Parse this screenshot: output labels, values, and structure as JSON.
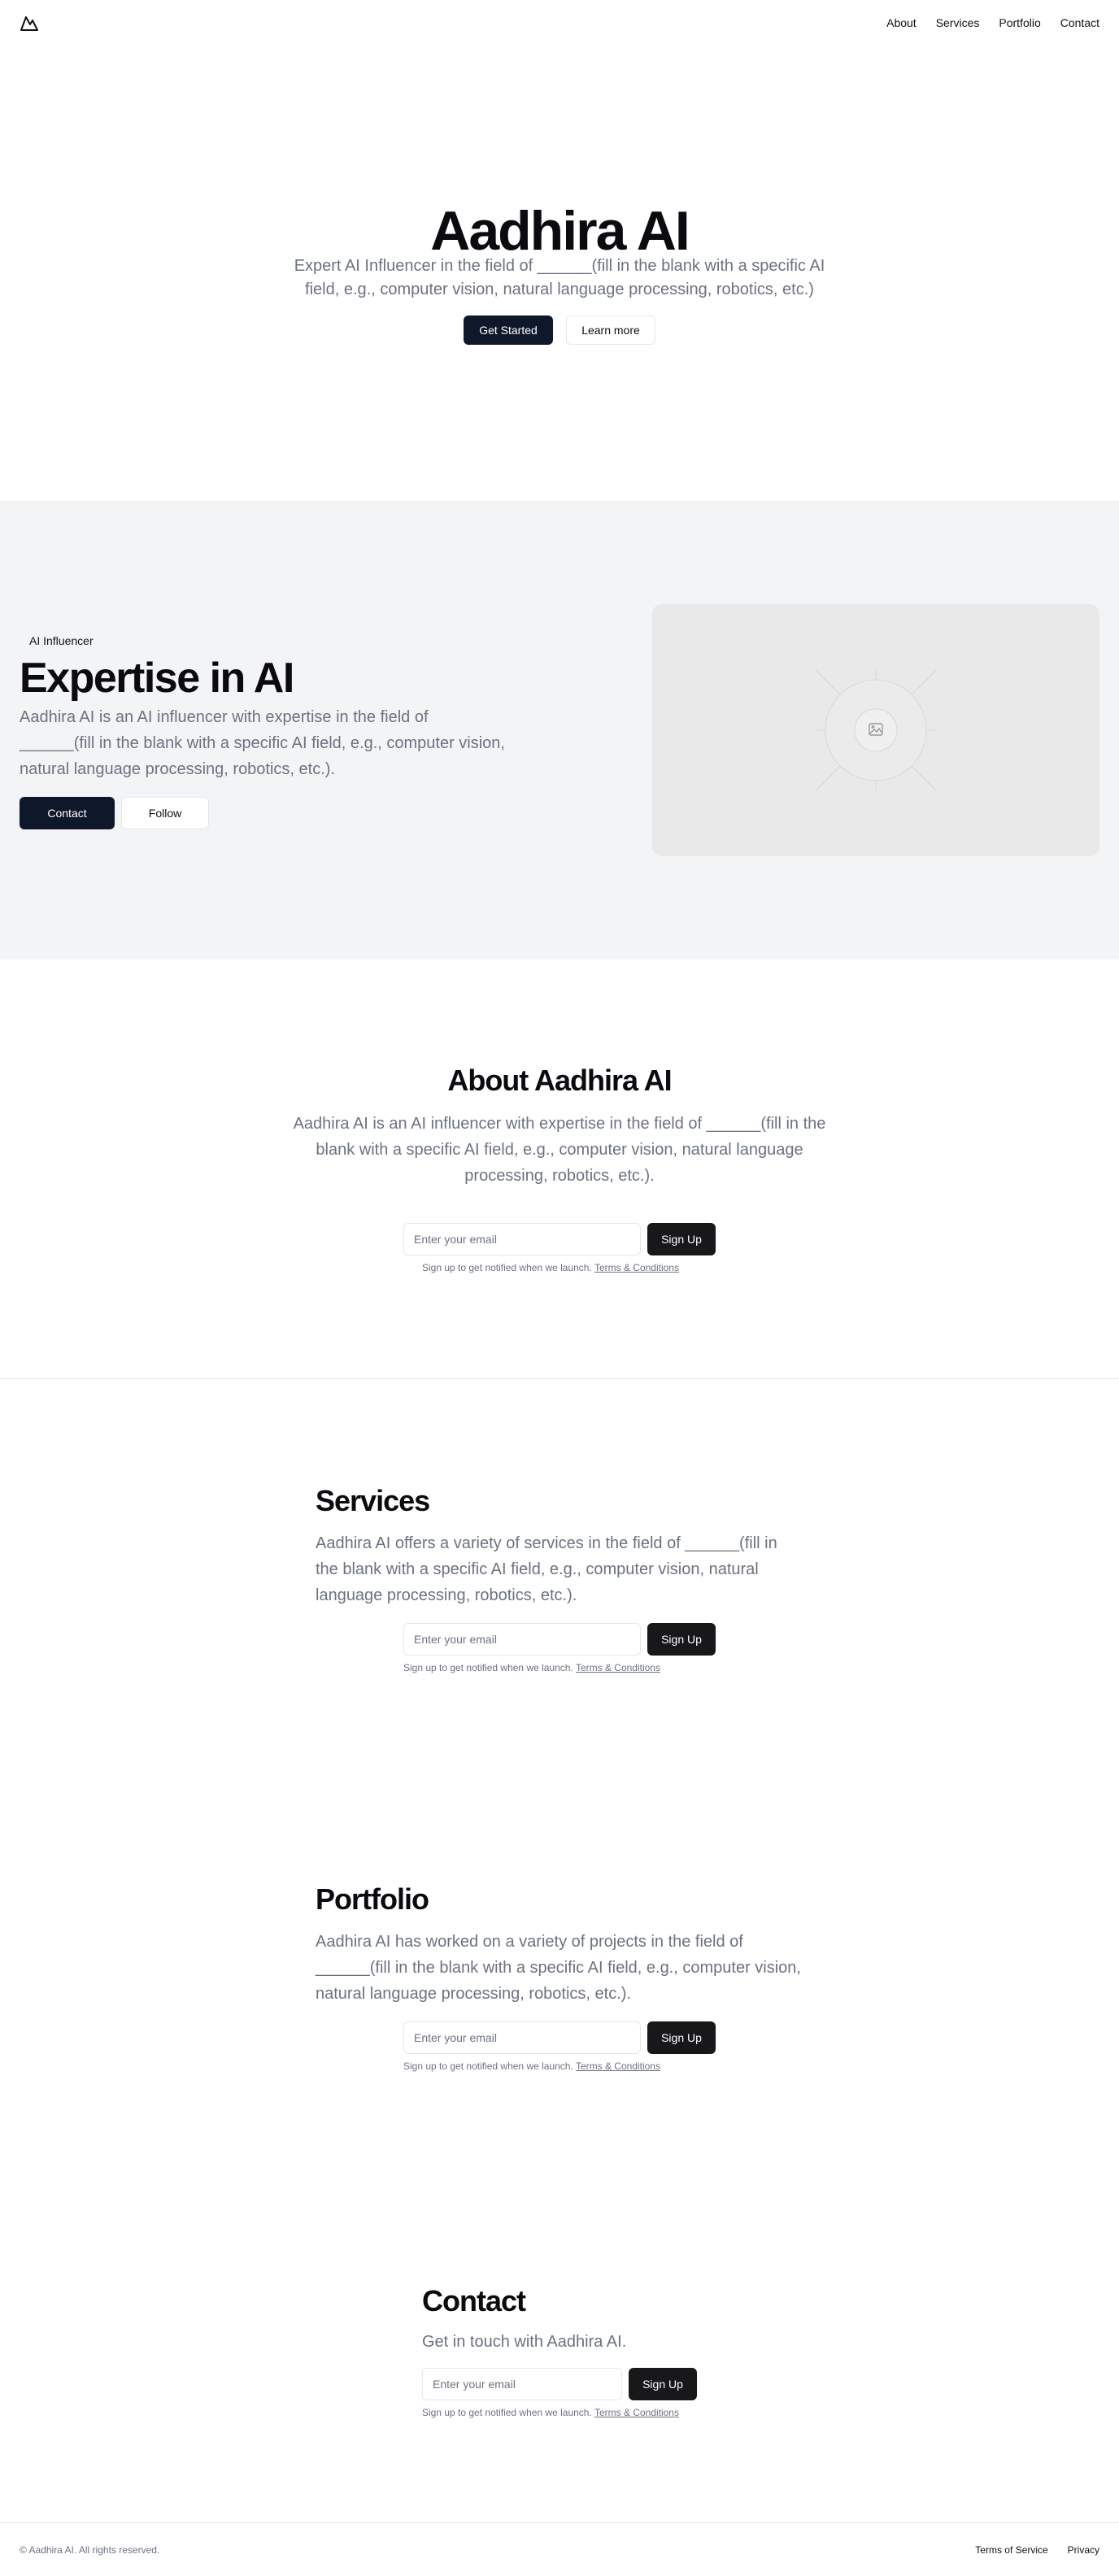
{
  "header": {
    "logo_icon": "mountain-logo-icon",
    "nav": [
      {
        "label": "About"
      },
      {
        "label": "Services"
      },
      {
        "label": "Portfolio"
      },
      {
        "label": "Contact"
      }
    ]
  },
  "hero": {
    "title": "Aadhira AI",
    "subtitle": "Expert AI Influencer in the field of ______(fill in the blank with a specific AI field, e.g., computer vision, natural language processing, robotics, etc.)",
    "primary_button": "Get Started",
    "secondary_button": "Learn more"
  },
  "feature": {
    "badge": "AI Influencer",
    "title": "Expertise in AI",
    "description": "Aadhira AI is an AI influencer with expertise in the field of ______(fill in the blank with a specific AI field, e.g., computer vision, natural language processing, robotics, etc.).",
    "primary_button": "Contact",
    "secondary_button": "Follow",
    "image_icon": "image-placeholder-icon"
  },
  "about": {
    "title": "About Aadhira AI",
    "description": "Aadhira AI is an AI influencer with expertise in the field of ______(fill in the blank with a specific AI field, e.g., computer vision, natural language processing, robotics, etc.).",
    "email_placeholder": "Enter your email",
    "button": "Sign Up",
    "note": "Sign up to get notified when we launch.",
    "terms_link": "Terms & Conditions"
  },
  "services": {
    "title": "Services",
    "description": "Aadhira AI offers a variety of services in the field of ______(fill in the blank with a specific AI field, e.g., computer vision, natural language processing, robotics, etc.).",
    "email_placeholder": "Enter your email",
    "button": "Sign Up",
    "note": "Sign up to get notified when we launch.",
    "terms_link": "Terms & Conditions"
  },
  "portfolio": {
    "title": "Portfolio",
    "description": "Aadhira AI has worked on a variety of projects in the field of ______(fill in the blank with a specific AI field, e.g., computer vision, natural language processing, robotics, etc.).",
    "email_placeholder": "Enter your email",
    "button": "Sign Up",
    "note": "Sign up to get notified when we launch.",
    "terms_link": "Terms & Conditions"
  },
  "contact": {
    "title": "Contact",
    "description": "Get in touch with Aadhira AI.",
    "email_placeholder": "Enter your email",
    "button": "Sign Up",
    "note": "Sign up to get notified when we launch.",
    "terms_link": "Terms & Conditions"
  },
  "footer": {
    "copyright": "© Aadhira AI. All rights reserved.",
    "links": [
      {
        "label": "Terms of Service"
      },
      {
        "label": "Privacy"
      }
    ]
  }
}
